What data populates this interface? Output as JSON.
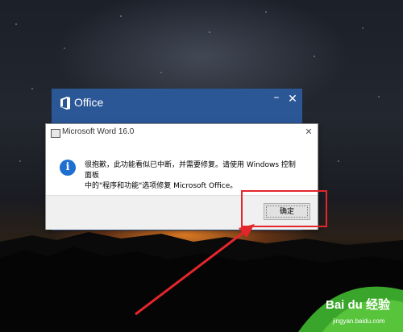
{
  "office_window": {
    "title": "Office",
    "minimize_glyph": "–",
    "close_glyph": "✕",
    "accent_color": "#2b5797"
  },
  "dialog": {
    "title": "Microsoft Word 16.0",
    "close_glyph": "✕",
    "icon": "info-icon",
    "message_line1": "很抱歉，此功能看似已中断，并需要修复。请使用 Windows 控制面板",
    "message_line2": "中的\"程序和功能\"选项修复 Microsoft Office。",
    "ok_label": "确定"
  },
  "annotation": {
    "color": "#e3262c"
  },
  "watermark": {
    "brand": "Bai du 经验",
    "url": "jingyan.baidu.com"
  }
}
